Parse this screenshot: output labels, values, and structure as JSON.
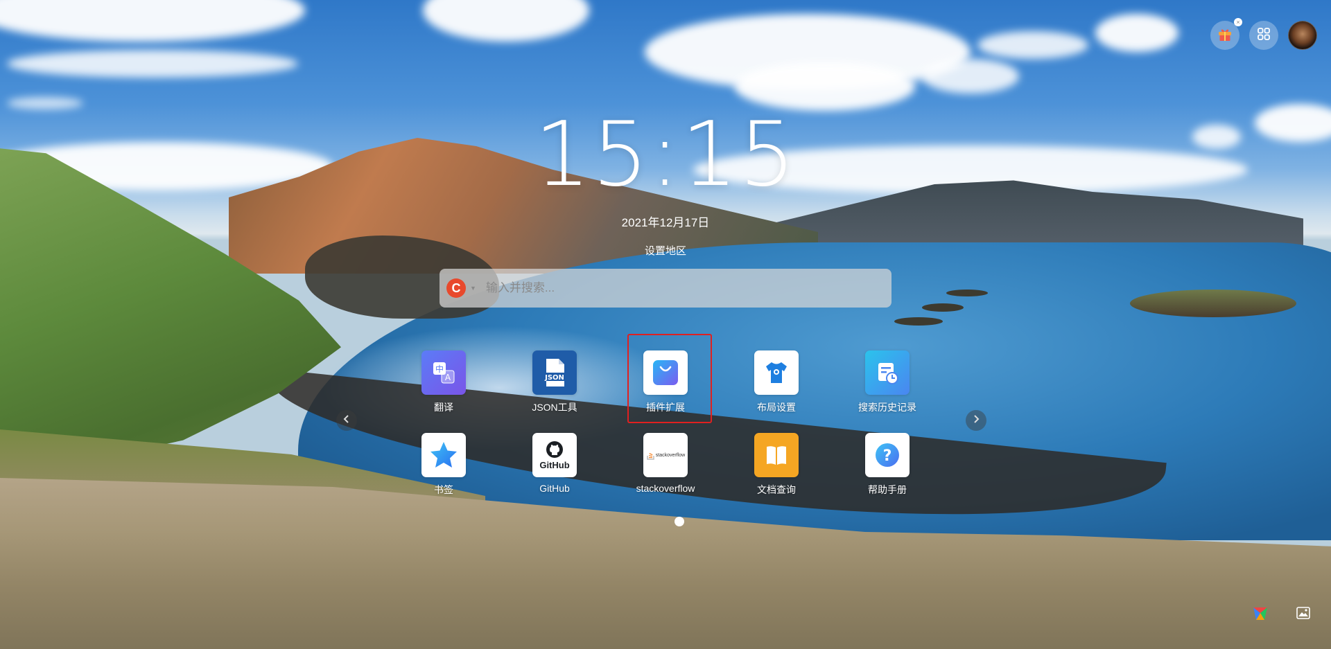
{
  "clock": {
    "time": "15:15",
    "date": "2021年12月17日",
    "region_link": "设置地区"
  },
  "search": {
    "placeholder": "输入并搜索...",
    "engine_letter": "C",
    "engine_color": "#e8492c"
  },
  "top_right": {
    "icons": [
      "gift-icon",
      "apps-grid-icon",
      "avatar"
    ],
    "gift_badge": "×"
  },
  "apps": [
    {
      "label": "翻译",
      "icon": "translate-icon"
    },
    {
      "label": "JSON工具",
      "icon": "json-icon"
    },
    {
      "label": "插件扩展",
      "icon": "shopping-bag-icon",
      "highlighted": true
    },
    {
      "label": "布局设置",
      "icon": "tshirt-icon"
    },
    {
      "label": "搜索历史记录",
      "icon": "history-icon"
    },
    {
      "label": "书签",
      "icon": "star-icon"
    },
    {
      "label": "GitHub",
      "icon": "github-icon",
      "tile_text": "GitHub"
    },
    {
      "label": "stackoverflow",
      "icon": "stackoverflow-icon",
      "tile_text": "stackoverflow"
    },
    {
      "label": "文档查询",
      "icon": "book-icon"
    },
    {
      "label": "帮助手册",
      "icon": "help-icon"
    }
  ],
  "pagination": {
    "current_page": 1,
    "pages": 1
  },
  "bottom_right": {
    "icons": [
      "color-palette-icon",
      "wallpaper-icon"
    ]
  }
}
